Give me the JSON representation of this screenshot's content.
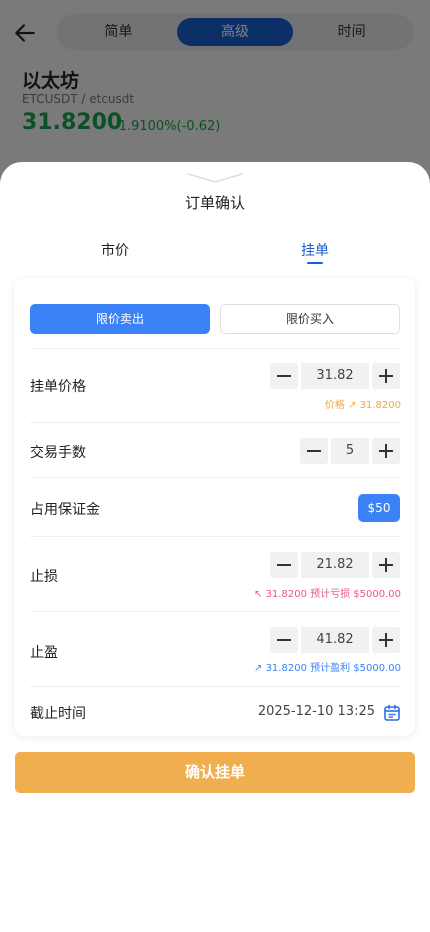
{
  "header": {
    "segments": [
      "简单",
      "高级",
      "时间"
    ],
    "active_segment": "高级"
  },
  "coin": {
    "name": "以太坊",
    "pair": "ETCUSDT / etcusdt",
    "price": "31.8200",
    "change": "-1.9100%(-0.62)"
  },
  "sheet": {
    "title": "订单确认",
    "tabs": {
      "market": "市价",
      "limit": "挂单"
    },
    "direction": {
      "sell": "限价卖出",
      "buy": "限价买入"
    },
    "limit_price": {
      "label": "挂单价格",
      "value": "31.82",
      "hint": "价格 ↗ 31.8200"
    },
    "lots": {
      "label": "交易手数",
      "value": "5"
    },
    "margin": {
      "label": "占用保证金",
      "value": "$50"
    },
    "stop_loss": {
      "label": "止损",
      "value": "21.82",
      "hint": "↖ 31.8200 预计亏损 $5000.00"
    },
    "take_profit": {
      "label": "止盈",
      "value": "41.82",
      "hint": "↗ 31.8200 预计盈利 $5000.00"
    },
    "deadline": {
      "label": "截止时间",
      "value": "2025-12-10 13:25"
    },
    "confirm_label": "确认挂单"
  },
  "colors": {
    "accent": "#3b82f6",
    "segment_active": "#1a5fcf",
    "confirm": "#f0ae4e",
    "gain": "#16a34a",
    "loss_hint": "#e8597d",
    "price_hint": "#f0a93c"
  },
  "icons": [
    "back-arrow-icon",
    "grabber-chevron-icon",
    "calendar-icon"
  ]
}
